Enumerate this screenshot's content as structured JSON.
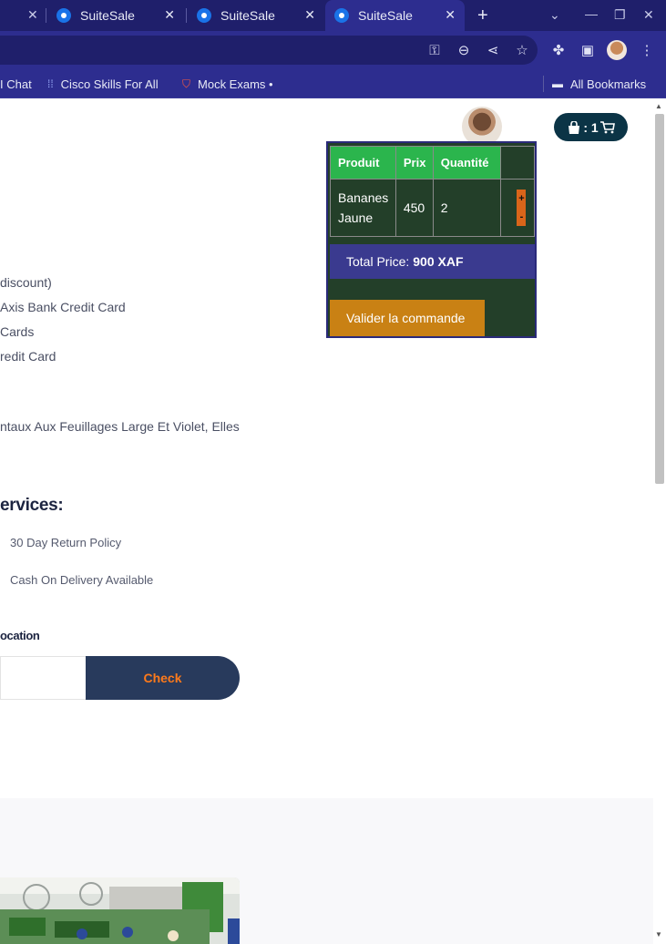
{
  "browser": {
    "tabs": [
      {
        "title": "SuiteSale"
      },
      {
        "title": "SuiteSale"
      },
      {
        "title": "SuiteSale"
      }
    ],
    "bookmarks": [
      {
        "label": "I Chat"
      },
      {
        "label": "Cisco Skills For All"
      },
      {
        "label": "Mock Exams •"
      }
    ],
    "all_bookmarks": "All Bookmarks"
  },
  "product": {
    "offers": [
      "discount)",
      "Axis Bank Credit Card",
      "Cards",
      "redit Card"
    ],
    "description": "ntaux Aux Feuillages Large Et Violet, Elles",
    "services_title": "ervices:",
    "services": [
      "30 Day Return Policy",
      "Cash On Delivery Available"
    ],
    "location_label": "ocation",
    "check_label": "Check"
  },
  "cart": {
    "badge_count": ": 1",
    "headers": [
      "Produit",
      "Prix",
      "Quantité"
    ],
    "items": [
      {
        "name": "Bananes Jaune",
        "price": "450",
        "qty": "2"
      }
    ],
    "plus": "+",
    "minus": "-",
    "total_label": "Total Price:",
    "total_value": "900 XAF",
    "validate_label": "Valider la commande"
  },
  "colors": {
    "browser_bg": "#2d2d8f",
    "cart_header": "#2bb54d",
    "cart_body": "#233f29",
    "total_bar": "#3a3a8f",
    "validate_button": "#c98114",
    "check_button": "#283a5c",
    "check_text": "#ff7a1a",
    "cart_badge": "#0b3446"
  }
}
